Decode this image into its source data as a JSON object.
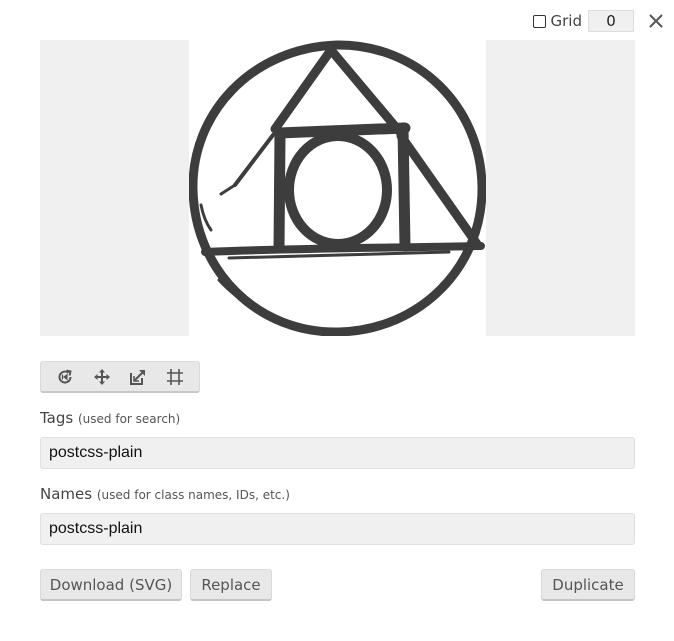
{
  "topbar": {
    "grid_label": "Grid",
    "grid_checked": false,
    "grid_value": "0",
    "close_icon": "close-icon"
  },
  "preview": {
    "icon_name": "postcss-plain",
    "icon_color": "#3d3d3d",
    "padding_color": "#f0f0f0"
  },
  "toolbar": {
    "tools": [
      {
        "name": "rotate-icon"
      },
      {
        "name": "move-icon"
      },
      {
        "name": "resize-icon"
      },
      {
        "name": "crop-icon"
      }
    ]
  },
  "tags": {
    "label": "Tags",
    "hint": "(used for search)",
    "value": "postcss-plain"
  },
  "names": {
    "label": "Names",
    "hint": "(used for class names, IDs, etc.)",
    "value": "postcss-plain"
  },
  "actions": {
    "download_label": "Download (SVG)",
    "replace_label": "Replace",
    "duplicate_label": "Duplicate"
  }
}
